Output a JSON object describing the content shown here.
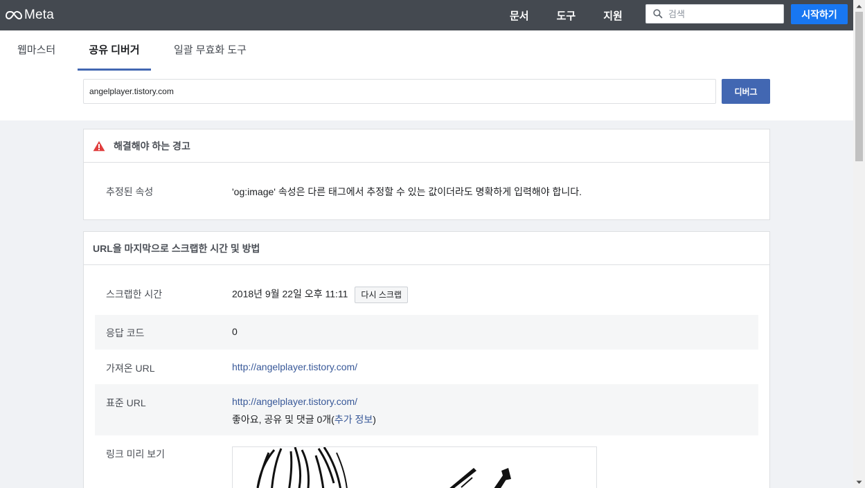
{
  "header": {
    "logo_text": "Meta",
    "nav": [
      "문서",
      "도구",
      "지원"
    ],
    "search_placeholder": "검색",
    "start_label": "시작하기"
  },
  "tabs": [
    {
      "label": "웹마스터",
      "active": false
    },
    {
      "label": "공유 디버거",
      "active": true
    },
    {
      "label": "일괄 무효화 도구",
      "active": false
    }
  ],
  "debugger": {
    "url_value": "angelplayer.tistory.com",
    "debug_label": "디버그"
  },
  "warnings": {
    "title": "해결해야 하는 경고",
    "items": [
      {
        "label": "추정된 속성",
        "message": "'og:image' 속성은 다른 태그에서 추정할 수 있는 값이더라도 명확하게 입력해야 합니다."
      }
    ]
  },
  "scrape": {
    "title": "URL을 마지막으로 스크랩한 시간 및 방법",
    "time_label": "스크랩한 시간",
    "time_value": "2018년 9월 22일 오후 11:11",
    "rescrape_label": "다시 스크랩",
    "response_label": "응답 코드",
    "response_value": "0",
    "fetched_label": "가져온 URL",
    "fetched_value": "http://angelplayer.tistory.com/",
    "canonical_label": "표준 URL",
    "canonical_value": "http://angelplayer.tistory.com/",
    "engagement_prefix": "좋아요, 공유 및 댓글 0개(",
    "engagement_link": "추가 정보",
    "engagement_suffix": ")",
    "preview_label": "링크 미리 보기"
  },
  "colors": {
    "topbar": "#444950",
    "primary": "#1877f2",
    "debug": "#4267b2",
    "link": "#385898",
    "warning": "#e03e3e"
  }
}
